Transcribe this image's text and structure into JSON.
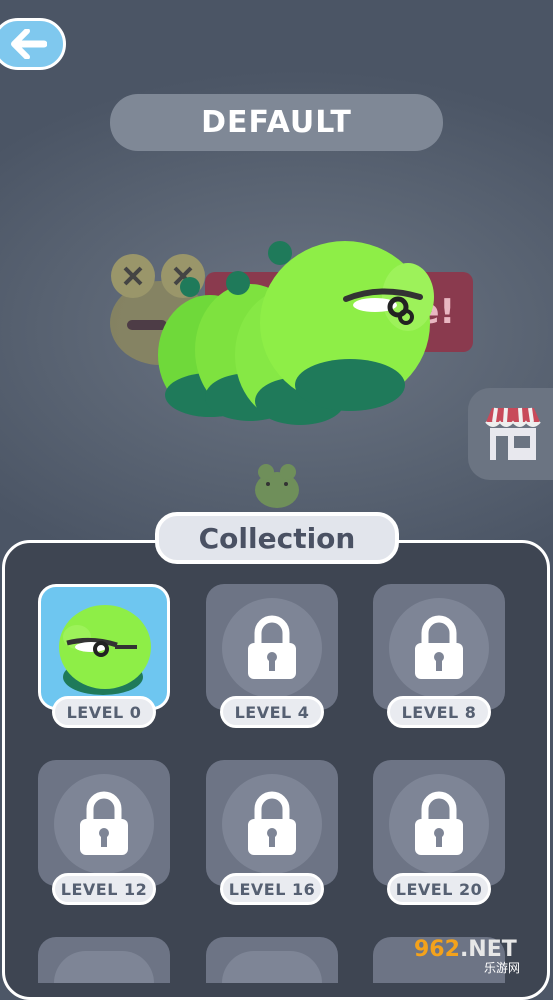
{
  "header": {
    "title": "DEFAULT",
    "back_icon": "arrow-left-icon"
  },
  "background": {
    "banner_text": "e!"
  },
  "shop": {
    "icon": "shop-icon"
  },
  "collection": {
    "title": "Collection",
    "items": [
      {
        "label": "LEVEL 0",
        "unlocked": true
      },
      {
        "label": "LEVEL 4",
        "unlocked": false
      },
      {
        "label": "LEVEL 8",
        "unlocked": false
      },
      {
        "label": "LEVEL 12",
        "unlocked": false
      },
      {
        "label": "LEVEL 16",
        "unlocked": false
      },
      {
        "label": "LEVEL 20",
        "unlocked": false
      }
    ]
  },
  "watermark": {
    "brand": "962",
    "suffix": ".NET",
    "sub": "乐游网"
  },
  "colors": {
    "accent": "#7fc8ee",
    "panel": "#3e4552",
    "card": "#6d7485",
    "selected": "#6ec6f0"
  }
}
